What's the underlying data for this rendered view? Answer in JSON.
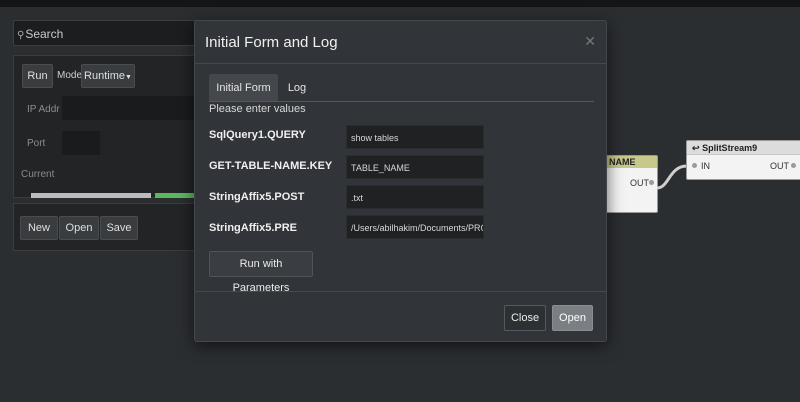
{
  "search": {
    "icon": "search-icon",
    "placeholder": "Search"
  },
  "run_panel": {
    "run_label": "Run",
    "mode_label": "Mode",
    "runtime_label": "Runtime",
    "ip_label": "IP Addr",
    "port_label": "Port",
    "current_label": "Current"
  },
  "file_panel": {
    "new_label": "New",
    "open_label": "Open",
    "save_label": "Save"
  },
  "nodes": {
    "node_a": {
      "title": "NAME",
      "out_label": "OUT"
    },
    "node_b": {
      "icon": "split-icon",
      "title": "SplitStream9",
      "in_label": "IN",
      "out_label": "OUT"
    }
  },
  "modal": {
    "title": "Initial Form and Log",
    "close_icon": "close-icon",
    "tabs": [
      {
        "label": "Initial Form",
        "active": true
      },
      {
        "label": "Log",
        "active": false
      }
    ],
    "subtitle": "Please enter values",
    "params": [
      {
        "label": "SqlQuery1.QUERY",
        "value": "show tables"
      },
      {
        "label": "GET-TABLE-NAME.KEY",
        "value": "TABLE_NAME"
      },
      {
        "label": "StringAffix5.POST",
        "value": ".txt"
      },
      {
        "label": "StringAffix5.PRE",
        "value": "/Users/abilhakim/Documents/PRO"
      }
    ],
    "run_params_label": "Run with Parameters",
    "close_label": "Close",
    "open_label": "Open"
  },
  "colors": {
    "background": "#2b2e31",
    "modal_bg": "#313438",
    "node_header_yellow": "#c7c98a",
    "progress_green": "#5cb85c"
  }
}
